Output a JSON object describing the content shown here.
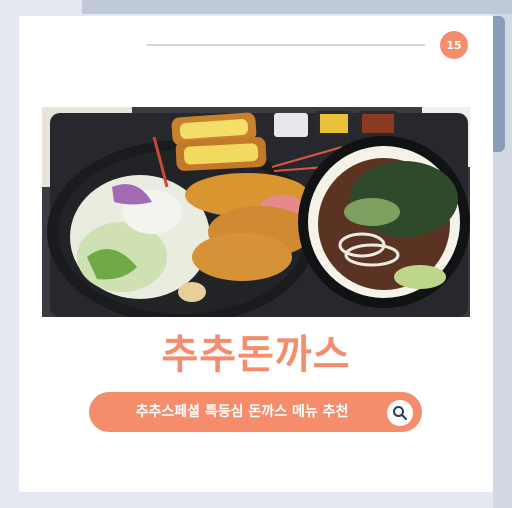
{
  "page": {
    "number": "15",
    "title": "추추돈까스",
    "search_text": "추추스페셜 특등심 돈까스 메뉴 추천"
  },
  "photo": {
    "subject": "tonkatsu-set-meal"
  },
  "colors": {
    "accent": "#f58d6c",
    "card": "#ffffff",
    "background": "#e4e8f1"
  },
  "icons": {
    "search": "search-icon"
  }
}
